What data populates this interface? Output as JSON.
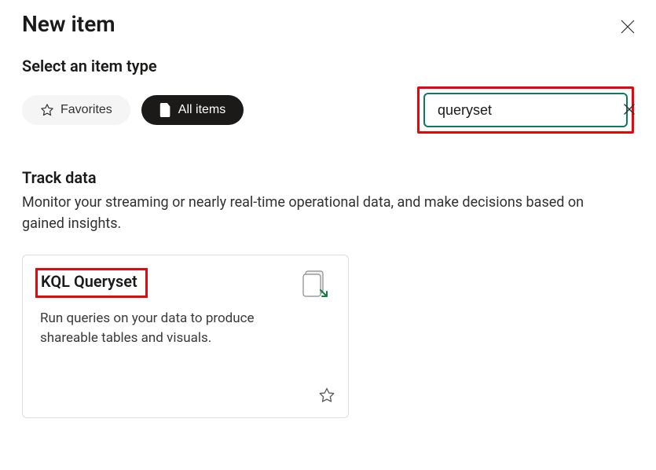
{
  "dialog": {
    "title": "New item",
    "subtitle": "Select an item type"
  },
  "filters": {
    "favorites_label": "Favorites",
    "all_items_label": "All items"
  },
  "search": {
    "value": "queryset",
    "placeholder": ""
  },
  "section": {
    "heading": "Track data",
    "description": "Monitor your streaming or nearly real-time operational data, and make decisions based on gained insights."
  },
  "card": {
    "title": "KQL Queryset",
    "description": "Run queries on your data to produce shareable tables and visuals.",
    "icon_name": "document-export-icon"
  },
  "highlights": {
    "search_highlighted": true,
    "card_title_highlighted": true
  }
}
